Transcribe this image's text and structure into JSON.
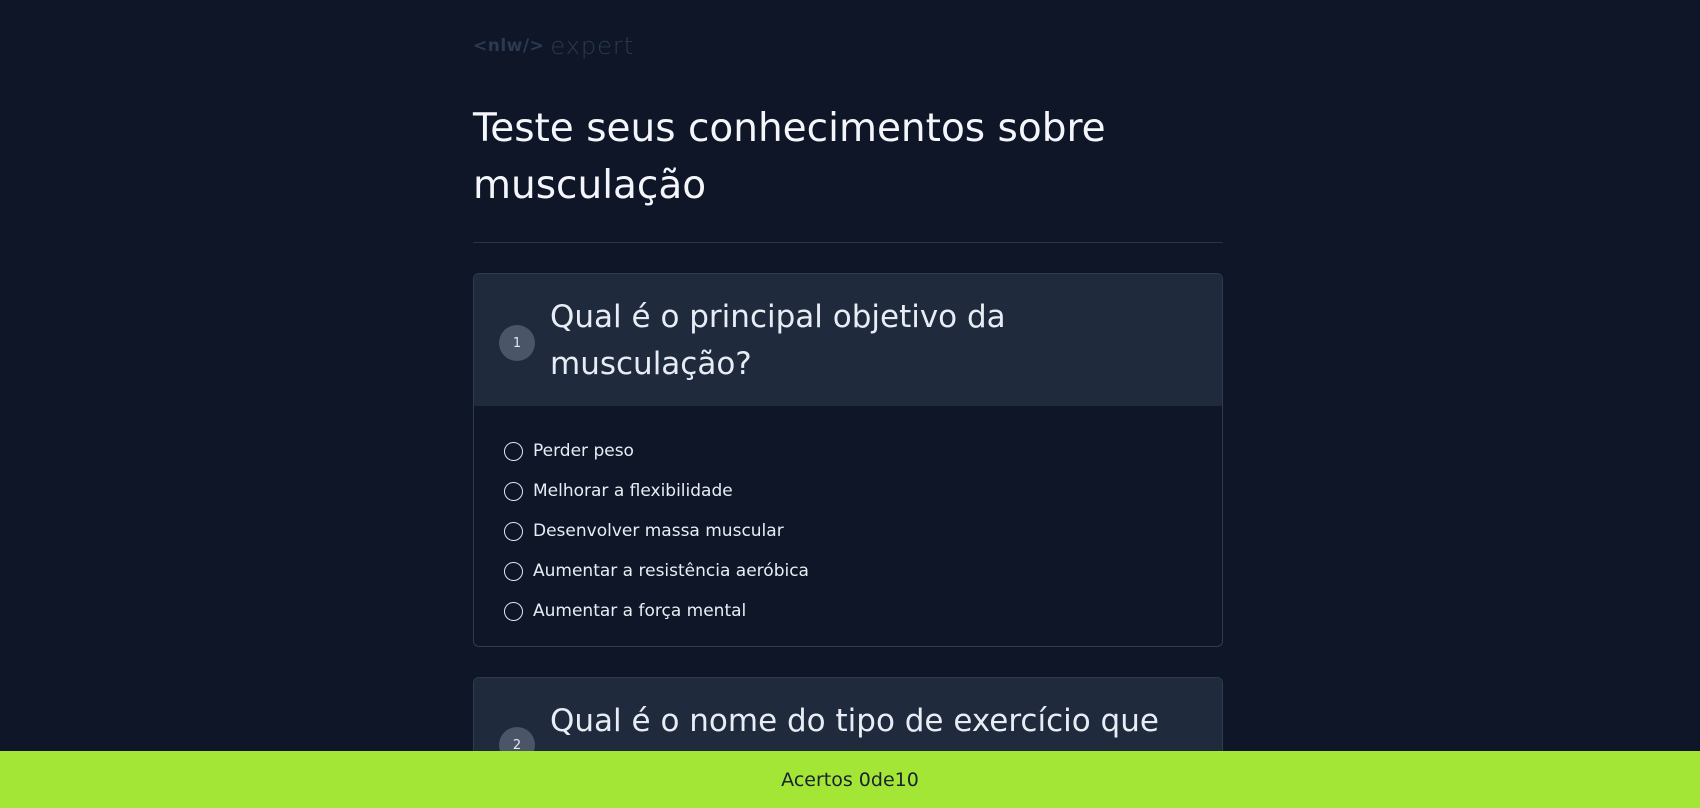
{
  "logo": {
    "tag": "<nlw/>",
    "word": "expert"
  },
  "title": "Teste seus conhecimentos sobre musculação",
  "questions": [
    {
      "number": "1",
      "text": "Qual é o principal objetivo da musculação?",
      "options": [
        "Perder peso",
        "Melhorar a flexibilidade",
        "Desenvolver massa muscular",
        "Aumentar a resistência aeróbica",
        "Aumentar a força mental"
      ]
    },
    {
      "number": "2",
      "text": "Qual é o nome do tipo de exercício que"
    }
  ],
  "footer": {
    "score_label": "Acertos 0de10"
  },
  "colors": {
    "background": "#0e1627",
    "card_header": "#1f2a3d",
    "footer": "#a3e635",
    "badge": "#4a5568"
  }
}
